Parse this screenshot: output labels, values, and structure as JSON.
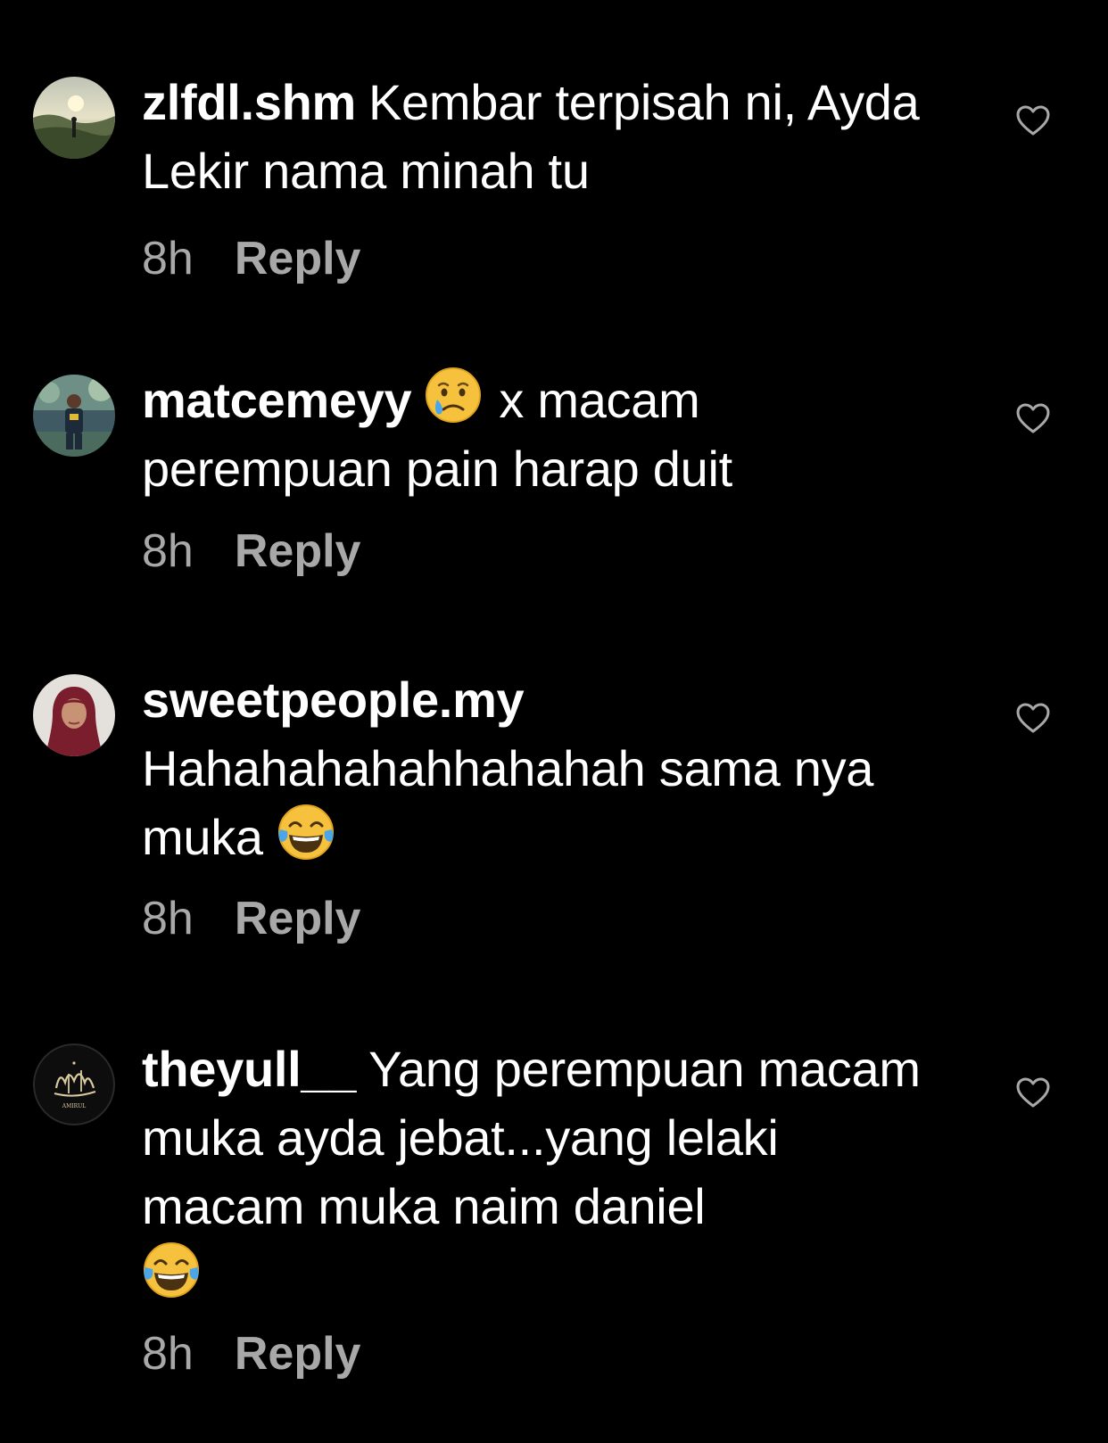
{
  "comments": [
    {
      "username": "zlfdl.shm",
      "text": "Kembar terpisah ni, Ayda Lekir nama minah tu",
      "time": "8h",
      "reply_label": "Reply",
      "avatar_icon": "landscape-avatar"
    },
    {
      "username": "matcemeyy",
      "emoji": "crying-face",
      "text": "x macam perempuan pain harap duit",
      "time": "8h",
      "reply_label": "Reply",
      "avatar_icon": "person-avatar"
    },
    {
      "username": "sweetpeople.my",
      "text": "Hahahahahahhahahah sama nya muka",
      "emoji": "face-with-tears-of-joy",
      "time": "8h",
      "reply_label": "Reply",
      "avatar_icon": "woman-hijab-avatar"
    },
    {
      "username": "theyull__",
      "text": "Yang perempuan macam muka ayda jebat...yang lelaki macam muka naim daniel",
      "emoji": "face-with-tears-of-joy",
      "time": "8h",
      "reply_label": "Reply",
      "avatar_icon": "calligraphy-avatar",
      "avatar_caption": "AMIRUL"
    }
  ],
  "colors": {
    "background": "#000000",
    "text": "#ffffff",
    "secondary": "#a8a8a8"
  }
}
